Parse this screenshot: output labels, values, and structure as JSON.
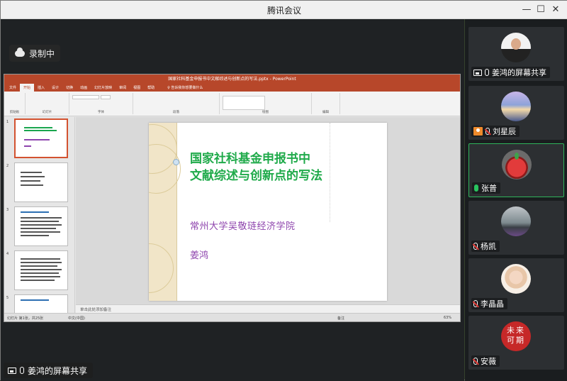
{
  "window": {
    "title": "腾讯会议"
  },
  "recording": {
    "label": "录制中"
  },
  "presenter": {
    "label": "姜鸿的屏幕共享"
  },
  "ppt": {
    "title_bar": "国家社科基金申报书中文献综述与创新点的写法.pptx - PowerPoint",
    "tabs": [
      "文件",
      "开始",
      "插入",
      "设计",
      "切换",
      "动画",
      "幻灯片放映",
      "审阅",
      "视图",
      "帮助"
    ],
    "tell_me": "♀ 告诉我你想要做什么",
    "ribbon_groups": [
      "剪贴板",
      "幻灯片",
      "字体",
      "段落",
      "绘图",
      "编辑"
    ],
    "notes_placeholder": "单击此处添加备注",
    "status": {
      "slide_info": "幻灯片 第1张，共25张",
      "lang": "中文(中国)",
      "notes": "备注",
      "zoom": "63%"
    },
    "thumb_numbers": [
      "1",
      "2",
      "3",
      "4",
      "5"
    ],
    "slide": {
      "title_line1": "国家社科基金申报书中",
      "title_line2": "文献综述与创新点的写法",
      "subtitle": "常州大学吴敬琏经济学院",
      "author": "姜鸿"
    }
  },
  "participants": [
    {
      "name": "姜鸿的屏幕共享",
      "icon": "screen-share-icon",
      "mic": "on"
    },
    {
      "name": "刘星辰",
      "icon": "avatar-placeholder-icon",
      "mic": "muted"
    },
    {
      "name": "张普",
      "mic": "speaking"
    },
    {
      "name": "杨凯",
      "mic": "muted"
    },
    {
      "name": "李晶晶",
      "mic": "muted"
    },
    {
      "name": "安薇",
      "mic": "muted",
      "avatar_text": "未来可期"
    }
  ],
  "colors": {
    "accent_green": "#2fb45a",
    "ppt_red": "#b7472a",
    "slide_green": "#1faa4a",
    "slide_purple": "#8e44ad"
  }
}
